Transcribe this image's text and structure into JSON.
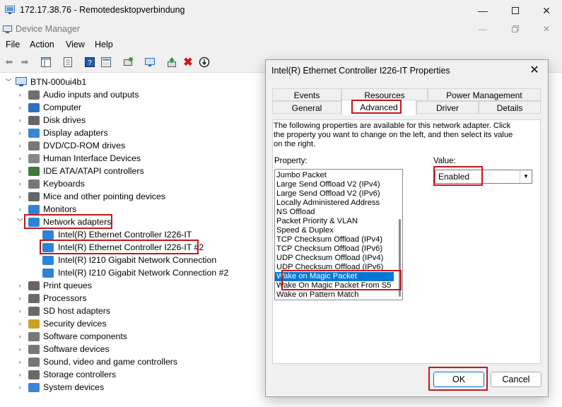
{
  "rdp": {
    "title": "172.17.38.76 - Remotedesktopverbindung"
  },
  "dm": {
    "title": "Device Manager"
  },
  "menu": [
    "File",
    "Action",
    "View",
    "Help"
  ],
  "tree": {
    "root": "BTN-000ui4b1",
    "items": [
      {
        "label": "Audio inputs and outputs",
        "color": "#6f6f6f"
      },
      {
        "label": "Computer",
        "color": "#2f6fc0"
      },
      {
        "label": "Disk drives",
        "color": "#666666"
      },
      {
        "label": "Display adapters",
        "color": "#3a86d4"
      },
      {
        "label": "DVD/CD-ROM drives",
        "color": "#777777"
      },
      {
        "label": "Human Interface Devices",
        "color": "#888888"
      },
      {
        "label": "IDE ATA/ATAPI controllers",
        "color": "#3c7a3c"
      },
      {
        "label": "Keyboards",
        "color": "#777777"
      },
      {
        "label": "Mice and other pointing devices",
        "color": "#666666"
      },
      {
        "label": "Monitors",
        "color": "#2f83d6"
      },
      {
        "label": "Network adapters",
        "color": "#2f83d6"
      },
      {
        "label": "Print queues",
        "color": "#666666"
      },
      {
        "label": "Processors",
        "color": "#6a6a6a"
      },
      {
        "label": "SD host adapters",
        "color": "#6a6a6a"
      },
      {
        "label": "Security devices",
        "color": "#c9a227"
      },
      {
        "label": "Software components",
        "color": "#777777"
      },
      {
        "label": "Software devices",
        "color": "#777777"
      },
      {
        "label": "Sound, video and game controllers",
        "color": "#777777"
      },
      {
        "label": "Storage controllers",
        "color": "#6a6a6a"
      },
      {
        "label": "System devices",
        "color": "#3a86d4"
      }
    ],
    "network_children": [
      "Intel(R) Ethernet Controller I226-IT",
      "Intel(R) Ethernet Controller I226-IT #2",
      "Intel(R) I210 Gigabit Network Connection",
      "Intel(R) I210 Gigabit Network Connection #2"
    ]
  },
  "dialog": {
    "title": "Intel(R) Ethernet Controller I226-IT Properties",
    "tabs_top": [
      "Events",
      "Resources",
      "Power Management"
    ],
    "tabs_bottom": [
      "General",
      "Advanced",
      "Driver",
      "Details"
    ],
    "description": "The following properties are available for this network adapter. Click the property you want to change on the left, and then select its value on the right.",
    "property_label": "Property:",
    "properties": [
      "Jumbo Packet",
      "Large Send Offload V2 (IPv4)",
      "Large Send Offload V2 (IPv6)",
      "Locally Administered Address",
      "NS Offload",
      "Packet Priority & VLAN",
      "Speed & Duplex",
      "TCP Checksum Offload (IPv4)",
      "TCP Checksum Offload (IPv6)",
      "UDP Checksum Offload (IPv4)",
      "UDP Checksum Offload (IPv6)",
      "Wake on Magic Packet",
      "Wake On Magic Packet From S5",
      "Wake on Pattern Match"
    ],
    "value_label": "Value:",
    "value": "Enabled",
    "ok": "OK",
    "cancel": "Cancel"
  },
  "highlight_color": "#c8151b",
  "selection_color": "#0078d7"
}
